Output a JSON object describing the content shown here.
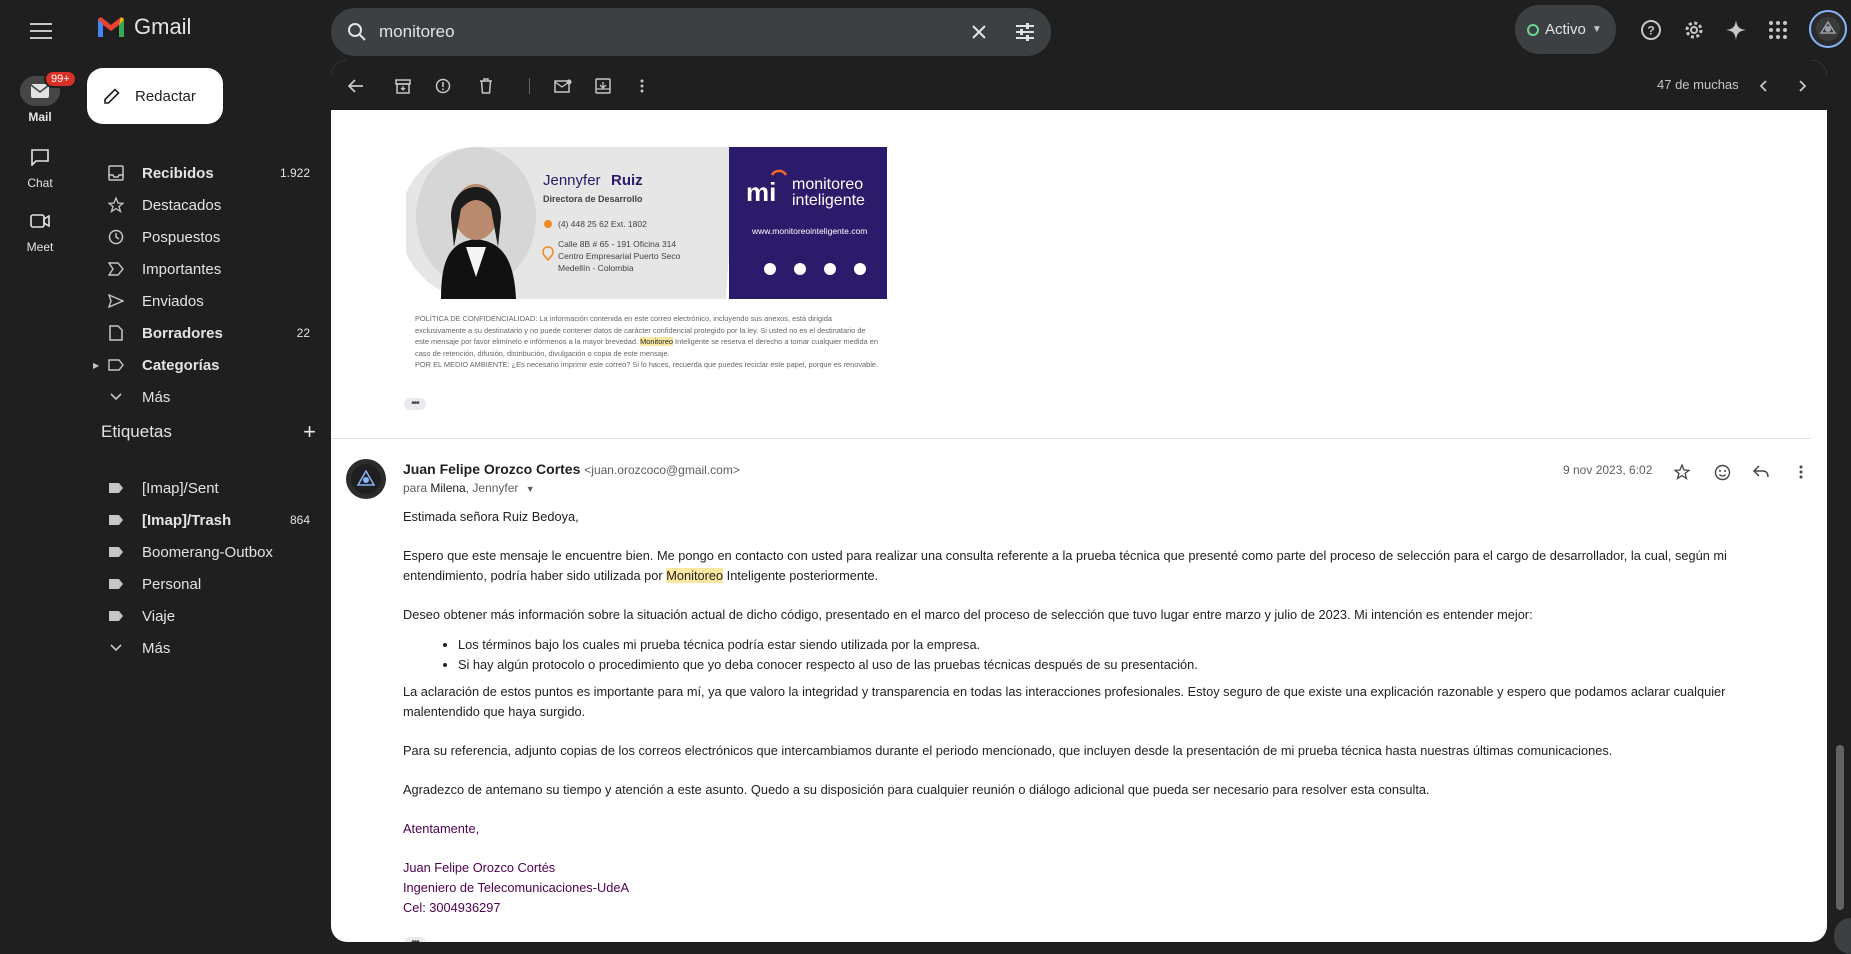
{
  "app": {
    "name": "Gmail"
  },
  "search": {
    "value": "monitoreo"
  },
  "status": {
    "label": "Activo"
  },
  "rail": {
    "mail": {
      "label": "Mail",
      "badge": "99+"
    },
    "chat": {
      "label": "Chat"
    },
    "meet": {
      "label": "Meet"
    }
  },
  "compose": {
    "label": "Redactar"
  },
  "nav": {
    "items": [
      {
        "label": "Recibidos",
        "count": "1.922",
        "bold": true
      },
      {
        "label": "Destacados",
        "count": ""
      },
      {
        "label": "Pospuestos",
        "count": ""
      },
      {
        "label": "Importantes",
        "count": ""
      },
      {
        "label": "Enviados",
        "count": ""
      },
      {
        "label": "Borradores",
        "count": "22",
        "bold": true
      },
      {
        "label": "Categorías",
        "count": "",
        "bold": true
      },
      {
        "label": "Más",
        "count": ""
      }
    ]
  },
  "labels": {
    "heading": "Etiquetas",
    "items": [
      {
        "label": "[Imap]/Sent",
        "count": ""
      },
      {
        "label": "[Imap]/Trash",
        "count": "864",
        "bold": true
      },
      {
        "label": "Boomerang-Outbox",
        "count": ""
      },
      {
        "label": "Personal",
        "count": ""
      },
      {
        "label": "Viaje",
        "count": ""
      },
      {
        "label": "Más",
        "count": ""
      }
    ]
  },
  "toolbar": {
    "count": "47 de muchas"
  },
  "signature_card": {
    "first_name": "Jennyfer",
    "last_name": "Ruiz",
    "role": "Directora de Desarrollo",
    "phone": "(4) 448 25 62 Ext. 1802",
    "address1": "Calle 8B # 65 - 191 Oficina 314",
    "address2": "Centro Empresarial Puerto Seco",
    "address3": "Medellín - Colombia",
    "brand1": "monitoreo",
    "brand2": "inteligente",
    "website": "www.monitoreointeligente.com"
  },
  "confidentiality": {
    "part1": "POLÍTICA DE CONFIDENCIALIDAD: La información contenida en este correo electrónico, incluyendo sus anexos, está dirigida exclusivamente a su destinatario y no puede contener datos de carácter confidencial protegido por la ley. Si usted no es el destinatario de este mensaje por favor elimínelo e infórmenos a la mayor brevedad. ",
    "highlight": "Monitoreo",
    "part2": " Inteligente se reserva el derecho a tomar cualquier medida en caso de retención, difusión, distribución, divulgación o copia de este mensaje.",
    "environment": "POR EL MEDIO AMBIENTE: ¿Es necesario imprimir este correo? Si lo haces, recuerda que puedes reciclar este papel, porque es renovable."
  },
  "message": {
    "sender_name": "Juan Felipe Orozco Cortes",
    "sender_email": "<juan.orozcoco@gmail.com>",
    "to_prefix": "para",
    "to_name1": "Milena",
    "to_name2": ", Jennyfer",
    "date": "9 nov 2023, 6:02",
    "greeting": "Estimada señora Ruiz Bedoya,",
    "p1_a": "Espero que este mensaje le encuentre bien. Me pongo en contacto con usted para realizar una consulta referente a la prueba técnica que presenté como parte del proceso de selección para el cargo de desarrollador, la cual, según mi entendimiento, podría haber sido utilizada por ",
    "p1_hl": "Monitoreo",
    "p1_b": " Inteligente posteriormente.",
    "p2": "Deseo obtener más información sobre la situación actual de dicho código, presentado en el marco del proceso de selección que tuvo lugar entre marzo y julio de 2023. Mi intención es entender mejor:",
    "bullet1": "Los términos bajo los cuales mi prueba técnica podría estar siendo utilizada por la empresa.",
    "bullet2": "Si hay algún protocolo o procedimiento que yo deba conocer respecto al uso de las pruebas técnicas después de su presentación.",
    "p3": "La aclaración de estos puntos es importante para mí, ya que valoro la integridad y transparencia en todas las interacciones profesionales. Estoy seguro de que existe una explicación razonable y espero que podamos aclarar cualquier malentendido que haya surgido.",
    "p4": "Para su referencia, adjunto copias de los correos electrónicos que intercambiamos durante el periodo mencionado, que incluyen desde la presentación de mi prueba técnica hasta nuestras últimas comunicaciones.",
    "p5": "Agradezco de antemano su tiempo y atención a este asunto. Quedo a su disposición para cualquier reunión o diálogo adicional que pueda ser necesario para resolver esta consulta.",
    "closing": "Atentamente,",
    "sig_name": "Juan Felipe Orozco Cortés",
    "sig_title": "Ingeniero de Telecomunicaciones-UdeA",
    "sig_phone": "Cel: 3004936297"
  },
  "colors": {
    "accent_dark": "#1f1f1f",
    "brand_navy": "#2c1a6b",
    "highlight": "#fce8a0",
    "signature": "#500050"
  }
}
